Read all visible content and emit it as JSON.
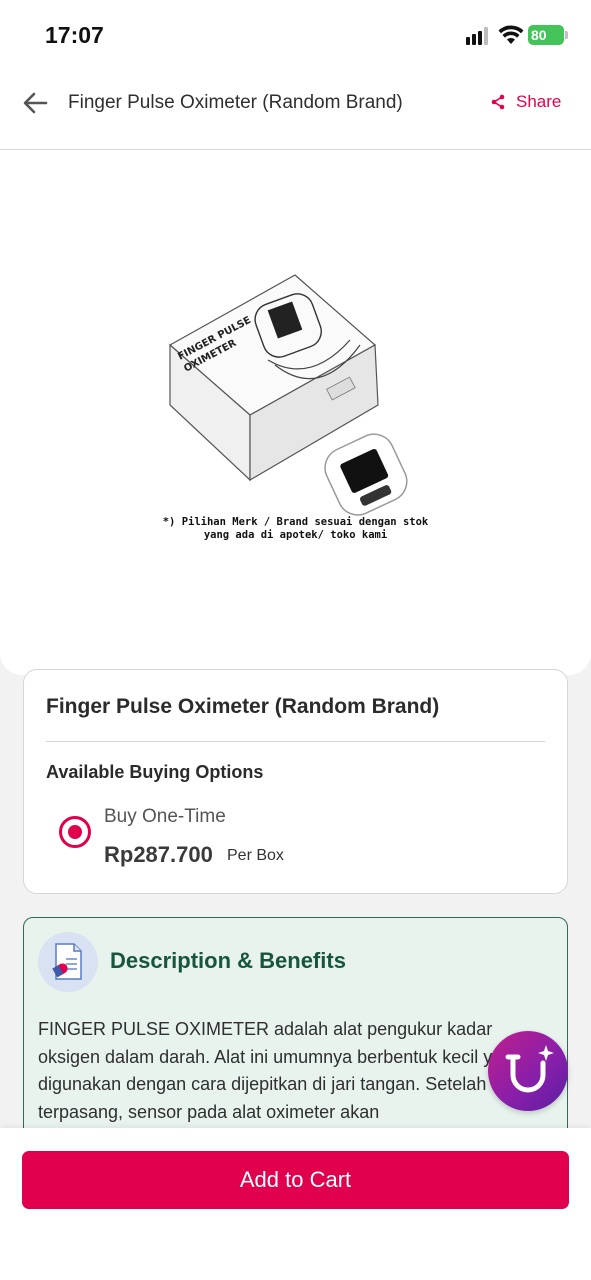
{
  "status_bar": {
    "time": "17:07",
    "battery": "80"
  },
  "header": {
    "title": "Finger Pulse Oximeter (Random Brand)",
    "share_label": "Share"
  },
  "product_image": {
    "box_text_line1": "FINGER PULSE",
    "box_text_line2": "OXIMETER",
    "caption_line1": "*) Pilihan Merk / Brand sesuai dengan stok",
    "caption_line2": "yang ada di apotek/ toko kami"
  },
  "product": {
    "name": "Finger Pulse Oximeter (Random Brand)",
    "options_heading": "Available Buying Options",
    "option": {
      "label": "Buy One-Time",
      "price": "Rp287.700",
      "unit": "Per Box",
      "selected": true
    }
  },
  "description": {
    "title": "Description & Benefits",
    "body": "FINGER PULSE OXIMETER adalah alat pengukur kadar oksigen dalam darah. Alat ini umumnya berbentuk kecil yang digunakan dengan cara dijepitkan di jari tangan. Setelah terpasang, sensor pada alat oximeter akan"
  },
  "actions": {
    "add_to_cart": "Add to Cart"
  },
  "colors": {
    "brand": "#e0004d",
    "description_accent": "#17553d",
    "description_bg": "#e8f3ee"
  },
  "icons": [
    "back-arrow-icon",
    "share-icon",
    "document-pill-icon",
    "assistant-stethoscope-icon",
    "signal-icon",
    "wifi-icon",
    "battery-icon"
  ]
}
